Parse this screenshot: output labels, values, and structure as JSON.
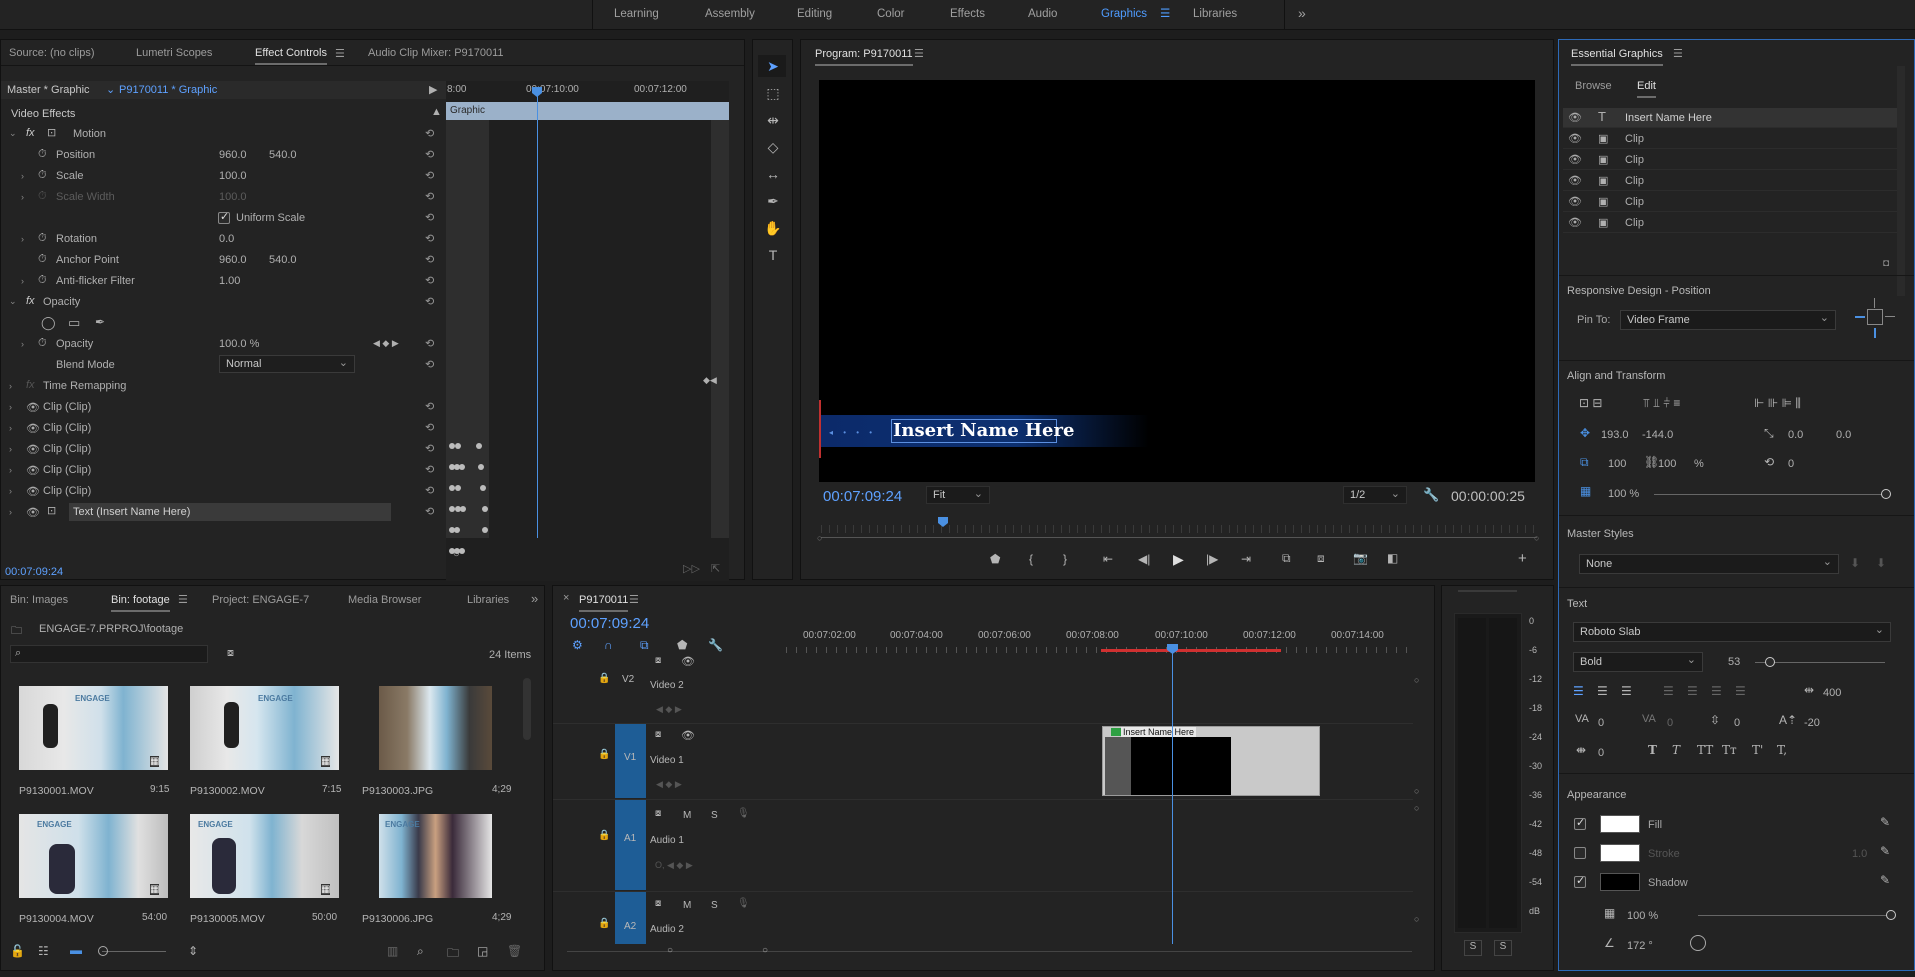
{
  "workspaces": [
    "Learning",
    "Assembly",
    "Editing",
    "Color",
    "Effects",
    "Audio",
    "Graphics",
    "Libraries"
  ],
  "active_workspace": "Graphics",
  "more_icon": "double-chevron-right-icon",
  "source_panel": {
    "tabs": [
      "Source: (no clips)",
      "Lumetri Scopes",
      "Effect Controls",
      "Audio Clip Mixer: P9170011"
    ],
    "master_label": "Master * Graphic",
    "clip_label": "P9170011 * Graphic",
    "timecodes": [
      "8:00",
      "00:07:10:00",
      "00:07:12:00"
    ],
    "graphic_label": "Graphic",
    "section": "Video Effects",
    "motion": "Motion",
    "position": {
      "label": "Position",
      "x": "960.0",
      "y": "540.0"
    },
    "scale": {
      "label": "Scale",
      "value": "100.0"
    },
    "scale_width": {
      "label": "Scale Width",
      "value": "100.0"
    },
    "uniform_scale": "Uniform Scale",
    "rotation": {
      "label": "Rotation",
      "value": "0.0"
    },
    "anchor": {
      "label": "Anchor Point",
      "x": "960.0",
      "y": "540.0"
    },
    "antiflicker": {
      "label": "Anti-flicker Filter",
      "value": "1.00"
    },
    "opacity_section": "Opacity",
    "opacity": {
      "label": "Opacity",
      "value": "100.0 %"
    },
    "blend": {
      "label": "Blend Mode",
      "value": "Normal"
    },
    "time_remap": "Time Remapping",
    "clips": [
      "Clip (Clip)",
      "Clip (Clip)",
      "Clip (Clip)",
      "Clip (Clip)",
      "Clip (Clip)"
    ],
    "text_layer": "Text (Insert Name Here)",
    "timecode": "00:07:09:24"
  },
  "program": {
    "title": "Program: P9170011",
    "overlay_text": "Insert Name Here",
    "timecode": "00:07:09:24",
    "fit": "Fit",
    "resolution": "1/2",
    "duration": "00:00:00:25"
  },
  "essential": {
    "title": "Essential Graphics",
    "tabs": [
      "Browse",
      "Edit"
    ],
    "layers": [
      {
        "type": "text",
        "label": "Insert Name Here"
      },
      {
        "type": "clip",
        "label": "Clip"
      },
      {
        "type": "clip",
        "label": "Clip"
      },
      {
        "type": "clip",
        "label": "Clip"
      },
      {
        "type": "clip",
        "label": "Clip"
      },
      {
        "type": "clip",
        "label": "Clip"
      }
    ],
    "responsive": "Responsive Design - Position",
    "pin_to_label": "Pin To:",
    "pin_to": "Video Frame",
    "align": "Align and Transform",
    "pos_x": "193.0",
    "pos_y": "-144.0",
    "anchor_x": "0.0",
    "anchor_y": "0.0",
    "scale_w": "100",
    "scale_h": "100",
    "scale_unit": "%",
    "rotation": "0",
    "opacity": "100 %",
    "opacity_fraction": 1.0,
    "master_styles": "Master Styles",
    "master_style_value": "None",
    "text": "Text",
    "font": "Roboto Slab",
    "weight": "Bold",
    "size": "53",
    "tracking_value": "400",
    "kerning": "0",
    "tracking": "0",
    "leading": "0",
    "baseline": "-20",
    "tsume": "0",
    "style_btns": [
      "T",
      "T",
      "TT",
      "Tт",
      "T'",
      "T,"
    ],
    "appearance": "Appearance",
    "fill": "Fill",
    "stroke": "Stroke",
    "stroke_width": "1.0",
    "shadow": "Shadow",
    "shadow_opacity": "100 %",
    "shadow_angle": "172 °"
  },
  "bin": {
    "tabs": [
      "Bin: Images",
      "Bin: footage",
      "Project: ENGAGE-7",
      "Media Browser",
      "Libraries"
    ],
    "path": "ENGAGE-7.PRPROJ\\footage",
    "count": "24 Items",
    "items": [
      {
        "name": "P9130001.MOV",
        "dur": "9:15"
      },
      {
        "name": "P9130002.MOV",
        "dur": "7:15"
      },
      {
        "name": "P9130003.JPG",
        "dur": "4;29"
      },
      {
        "name": "P9130004.MOV",
        "dur": "54:00"
      },
      {
        "name": "P9130005.MOV",
        "dur": "50:00"
      },
      {
        "name": "P9130006.JPG",
        "dur": "4;29"
      }
    ]
  },
  "timeline": {
    "title": "P9170011",
    "timecode": "00:07:09:24",
    "ruler": [
      "00:07:02:00",
      "00:07:04:00",
      "00:07:06:00",
      "00:07:08:00",
      "00:07:10:00",
      "00:07:12:00",
      "00:07:14:00"
    ],
    "tracks": [
      {
        "id": "V2",
        "name": "Video 2"
      },
      {
        "id": "V1",
        "name": "Video 1"
      },
      {
        "id": "A1",
        "name": "Audio 1"
      },
      {
        "id": "A2",
        "name": "Audio 2"
      }
    ],
    "clip_label": "Insert Name Here",
    "track_btn_m": "M",
    "track_btn_s": "S"
  },
  "meter": {
    "ticks": [
      "0",
      "-6",
      "-12",
      "-18",
      "-24",
      "-30",
      "-36",
      "-42",
      "-48",
      "-54",
      "dB"
    ],
    "solo": [
      "S",
      "S"
    ]
  },
  "colors": {
    "accent": "#2d8ceb",
    "blue_text": "#5ea1ff",
    "playhead": "#4a90e2",
    "in_out": "#d03030"
  }
}
